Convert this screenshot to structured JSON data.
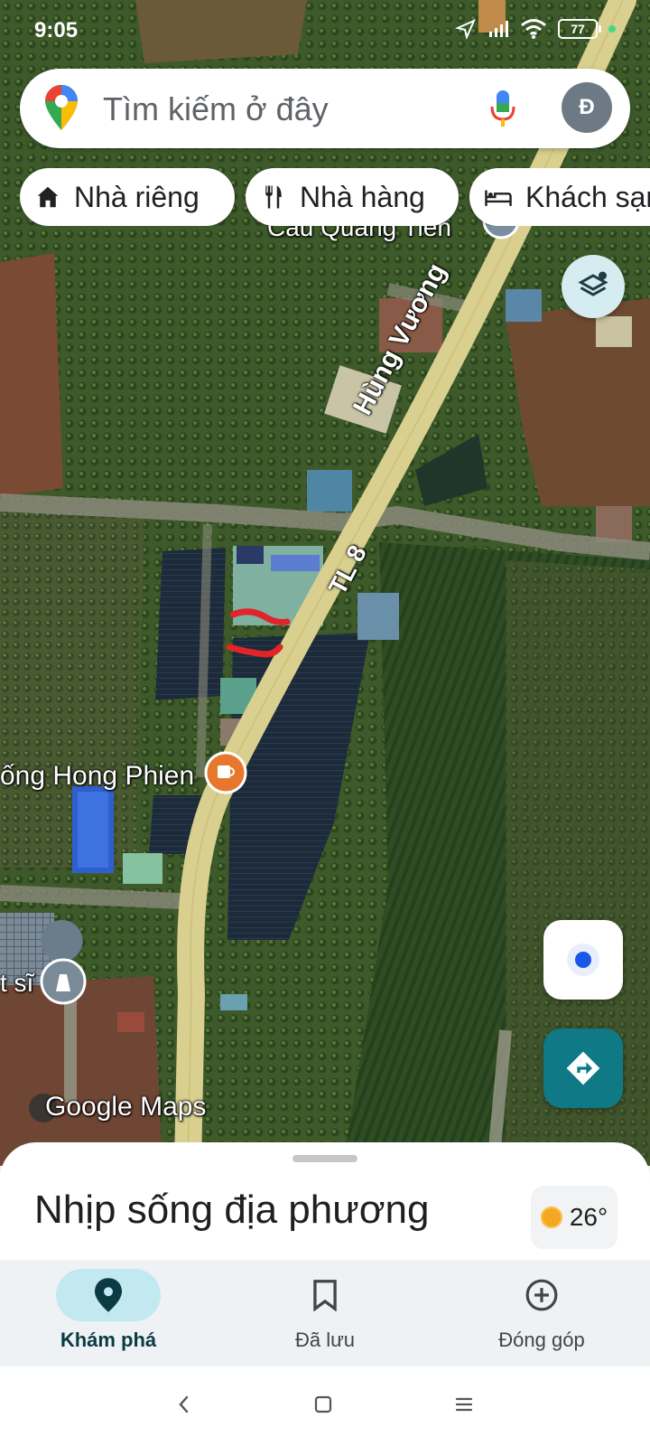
{
  "status_bar": {
    "time": "9:05",
    "battery": "77"
  },
  "search": {
    "placeholder": "Tìm kiếm ở đây",
    "avatar_letter": "Đ"
  },
  "chips": [
    {
      "label": "Nhà riêng",
      "icon": "home-icon"
    },
    {
      "label": "Nhà hàng",
      "icon": "restaurant-icon"
    },
    {
      "label": "Khách sạn",
      "icon": "hotel-icon"
    }
  ],
  "map": {
    "labels": {
      "bridge": "Cầu Quảng Tiến",
      "road_name": "Hùng Vương",
      "road_code": "TL 8",
      "cafe": "ống Hong Phien",
      "memorial": "t sĩ",
      "brand": "Google Maps"
    },
    "colors": {
      "road": "#d9cf8f",
      "accent": "#0f7a86",
      "marker": "#e8772e",
      "annotation": "#e0242a"
    }
  },
  "sheet": {
    "title": "Nhịp sống địa phương",
    "temperature": "26°"
  },
  "bottom_nav": [
    {
      "label": "Khám phá",
      "icon": "location-pin-icon",
      "active": true
    },
    {
      "label": "Đã lưu",
      "icon": "bookmark-icon",
      "active": false
    },
    {
      "label": "Đóng góp",
      "icon": "add-circle-icon",
      "active": false
    }
  ]
}
